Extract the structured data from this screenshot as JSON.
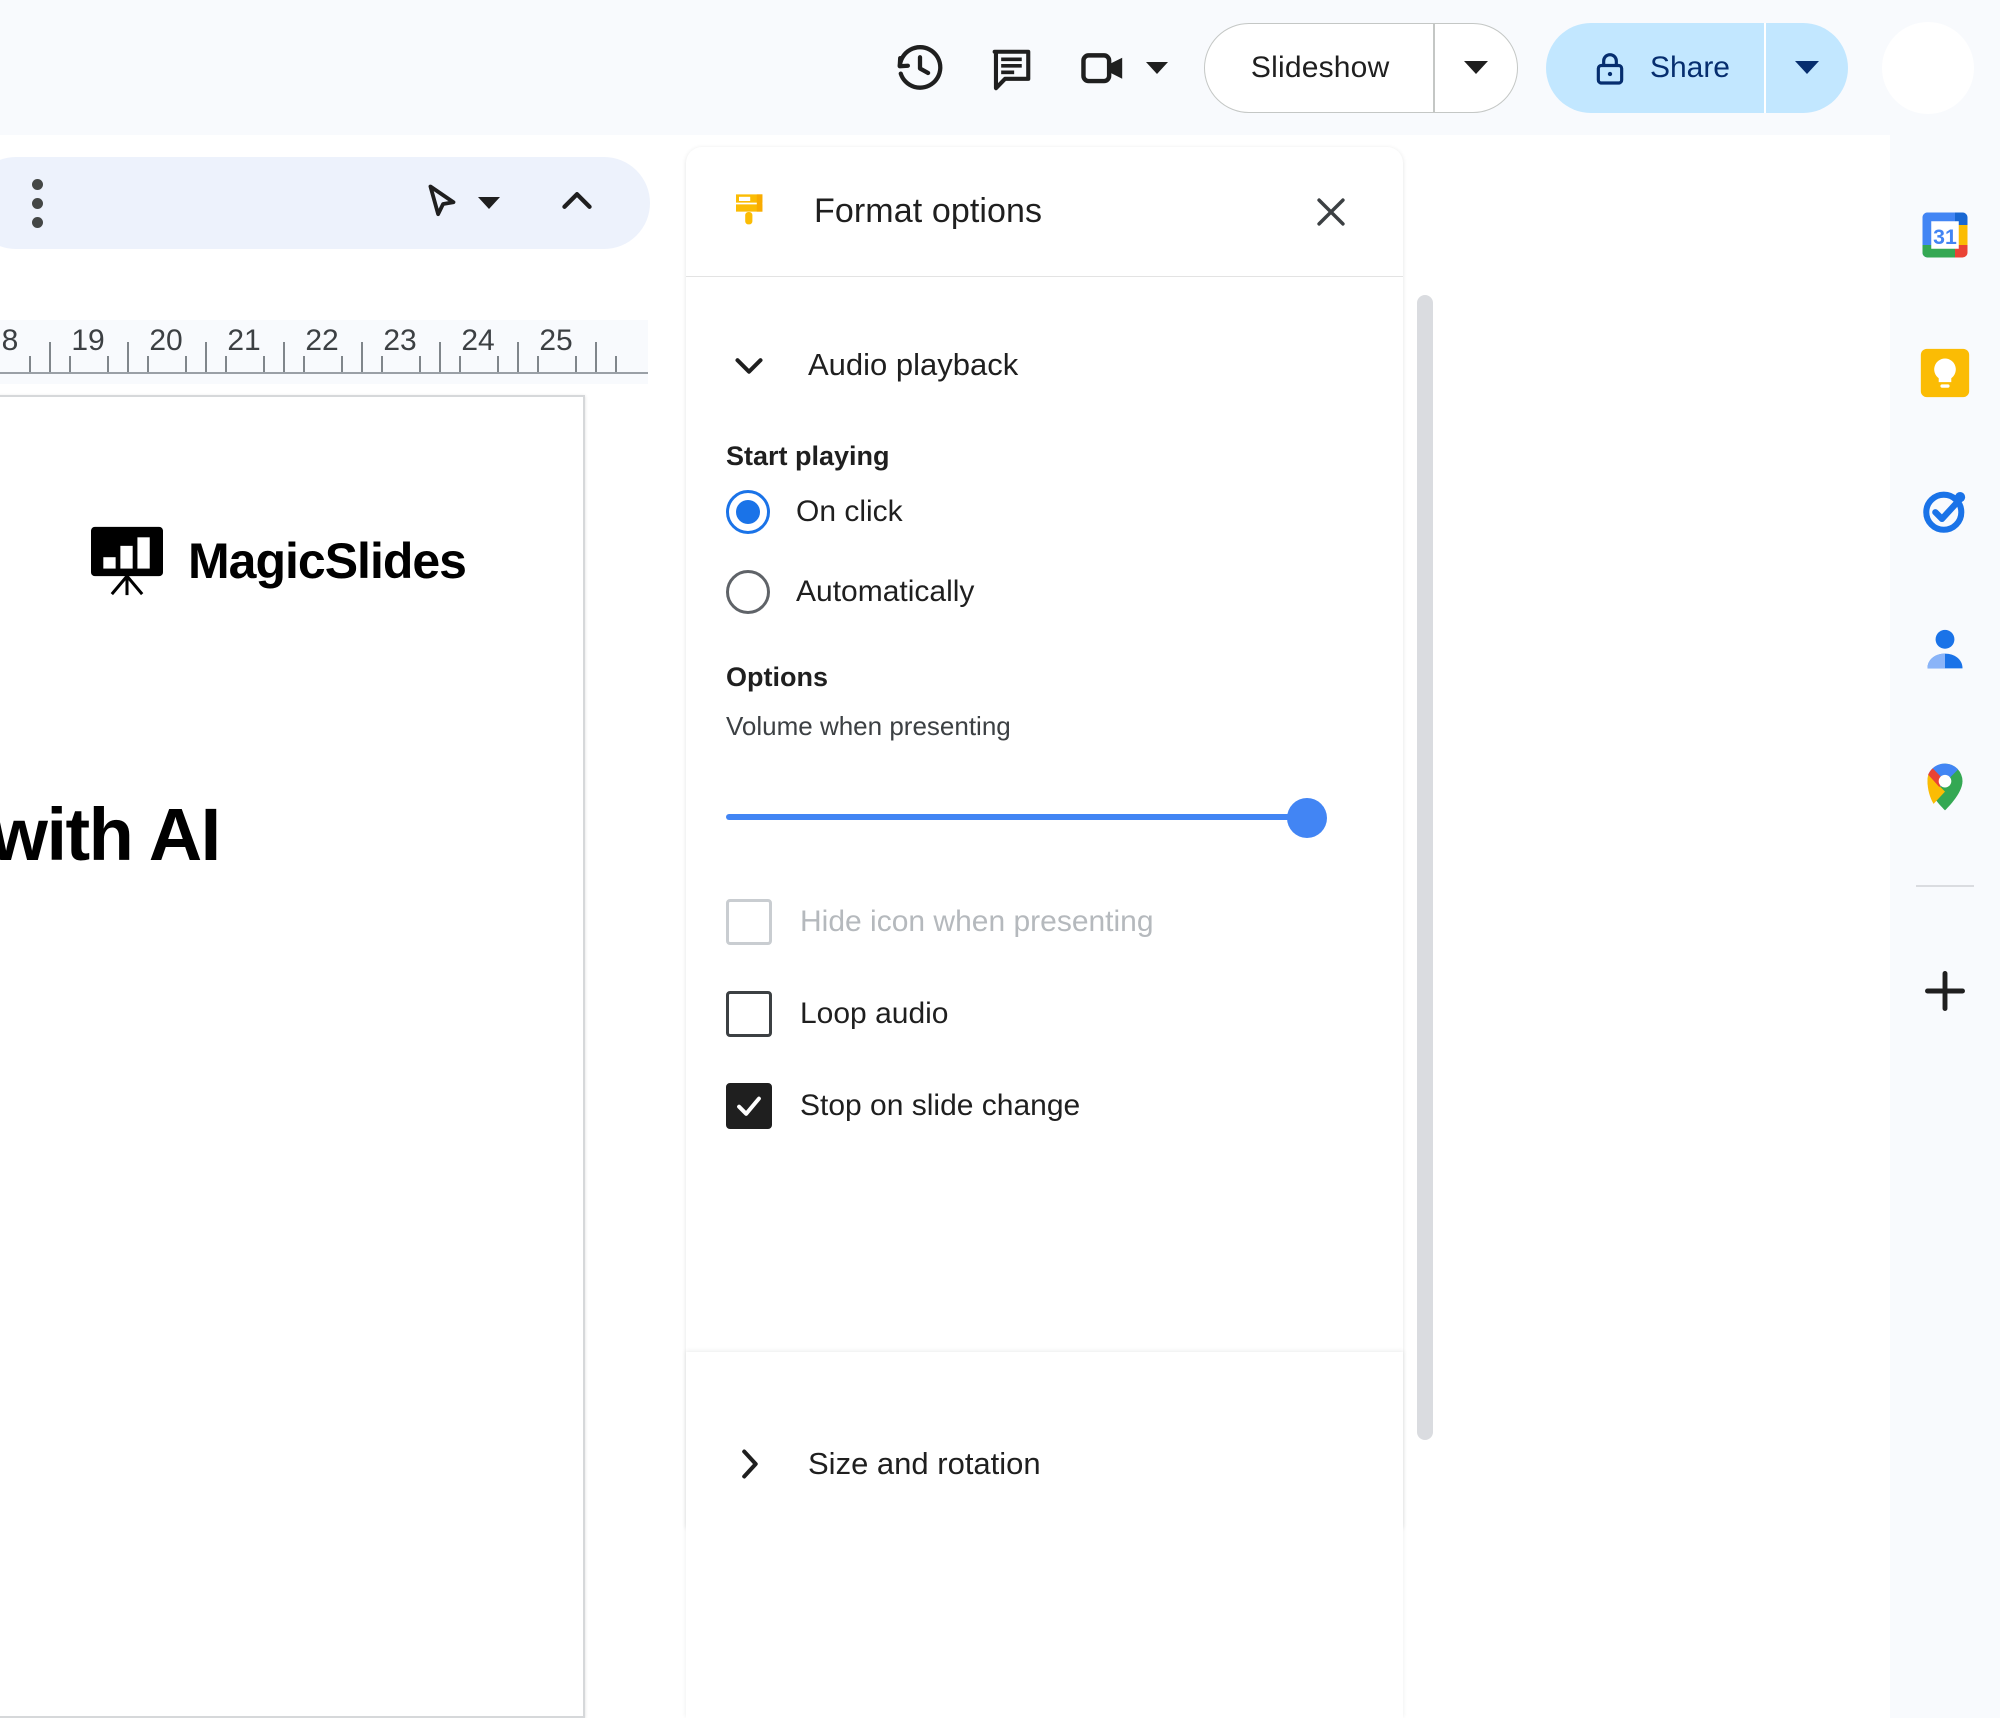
{
  "topbar": {
    "history_icon": "history-clock-icon",
    "comment_icon": "comment-icon",
    "meet_icon": "video-camera-icon",
    "meet_caret_icon": "caret-down-icon",
    "slideshow_label": "Slideshow",
    "slideshow_caret_icon": "caret-down-icon",
    "share_label": "Share",
    "share_lock_icon": "lock-icon",
    "share_caret_icon": "caret-down-icon",
    "avatar": "user-avatar"
  },
  "toolbar": {
    "more_icon": "three-dots-vertical-icon",
    "cursor_icon": "select-cursor-icon",
    "cursor_caret_icon": "caret-down-icon",
    "collapse_icon": "chevron-up-icon"
  },
  "ruler": {
    "unit_numbers": [
      "8",
      "19",
      "20",
      "21",
      "22",
      "23",
      "24",
      "25"
    ]
  },
  "slide": {
    "logo_word": "MagicSlides",
    "logo_icon": "presentation-easel-chart-icon",
    "title_text": "ds with AI"
  },
  "panel": {
    "icon": "paint-brush-icon",
    "title": "Format options",
    "close_icon": "close-x-icon",
    "accent_color": "#1a73e8",
    "brush_color": "#fbbc04",
    "sections": {
      "audio_playback": {
        "label": "Audio playback",
        "chevron_icon": "chevron-down-icon",
        "expanded": true,
        "start_playing_label": "Start playing",
        "radios": [
          {
            "label": "On click",
            "selected": true
          },
          {
            "label": "Automatically",
            "selected": false
          }
        ],
        "options_label": "Options",
        "volume_label": "Volume when presenting",
        "volume_value": 96,
        "checkboxes": [
          {
            "label": "Hide icon when presenting",
            "checked": false,
            "disabled": true
          },
          {
            "label": "Loop audio",
            "checked": false,
            "disabled": false
          },
          {
            "label": "Stop on slide change",
            "checked": true,
            "disabled": false
          }
        ]
      },
      "size_and_rotation": {
        "label": "Size and rotation",
        "chevron_icon": "chevron-right-icon",
        "expanded": false
      }
    },
    "scrollbar": "panel-scrollbar"
  },
  "side_rail": {
    "items": [
      {
        "name": "google-calendar-icon",
        "label": "31"
      },
      {
        "name": "google-keep-icon",
        "label": ""
      },
      {
        "name": "google-tasks-icon",
        "label": ""
      },
      {
        "name": "google-contacts-icon",
        "label": ""
      },
      {
        "name": "google-maps-icon",
        "label": ""
      }
    ],
    "add_label": "+",
    "add_icon": "plus-icon"
  }
}
